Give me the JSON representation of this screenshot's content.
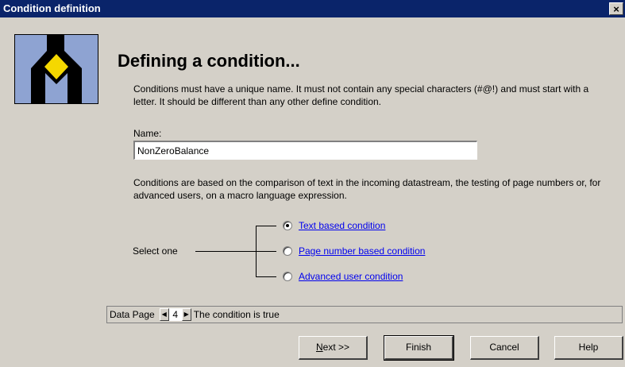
{
  "window": {
    "title": "Condition definition",
    "close_glyph": "×"
  },
  "header": {
    "heading": "Defining a condition...",
    "description": "Conditions must have a unique name. It must not contain any special characters (#@!) and must start with a letter. It should be different than any other define condition."
  },
  "name_field": {
    "label": "Name:",
    "value": "NonZeroBalance"
  },
  "conditions_description": "Conditions are based on the comparison of text in the incoming datastream, the testing of page numbers or, for advanced users, on a macro language expression.",
  "selector": {
    "label": "Select one",
    "options": [
      {
        "label": "Text based condition",
        "checked": true
      },
      {
        "label": "Page number based condition",
        "checked": false
      },
      {
        "label": "Advanced user condition",
        "checked": false
      }
    ]
  },
  "status": {
    "data_page_label": "Data Page",
    "page_number": "4",
    "prev_glyph": "◀",
    "next_glyph": "▶",
    "condition_text": "The condition is true"
  },
  "buttons": {
    "next_mnemonic": "N",
    "next_rest": "ext >>",
    "finish": "Finish",
    "cancel": "Cancel",
    "help": "Help"
  },
  "icons": [
    "wizard-logo-icon",
    "close-icon",
    "prev-page-icon",
    "next-page-icon"
  ]
}
